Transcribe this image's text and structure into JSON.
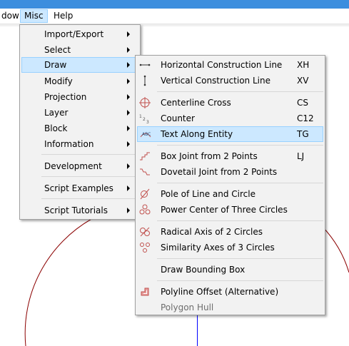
{
  "menubar": {
    "items": [
      {
        "label": "dow"
      },
      {
        "label": "Misc"
      },
      {
        "label": "Help"
      }
    ]
  },
  "misc_menu": {
    "items": [
      {
        "label": "Import/Export"
      },
      {
        "label": "Select"
      },
      {
        "label": "Draw"
      },
      {
        "label": "Modify"
      },
      {
        "label": "Projection"
      },
      {
        "label": "Layer"
      },
      {
        "label": "Block"
      },
      {
        "label": "Information"
      },
      {
        "label": "Development"
      },
      {
        "label": "Script Examples"
      },
      {
        "label": "Script Tutorials"
      }
    ]
  },
  "draw_menu": {
    "items": [
      {
        "label": "Horizontal Construction Line",
        "shortcut": "XH",
        "icon": "horizontal-line-icon"
      },
      {
        "label": "Vertical Construction Line",
        "shortcut": "XV",
        "icon": "vertical-line-icon"
      },
      {
        "label": "Centerline Cross",
        "shortcut": "CS",
        "icon": "centerline-cross-icon"
      },
      {
        "label": "Counter",
        "shortcut": "C12",
        "icon": "counter-icon"
      },
      {
        "label": "Text Along Entity",
        "shortcut": "TG",
        "icon": "text-along-entity-icon"
      },
      {
        "label": "Box Joint from 2 Points",
        "shortcut": "LJ",
        "icon": "box-joint-icon"
      },
      {
        "label": "Dovetail Joint from 2 Points",
        "shortcut": "",
        "icon": "dovetail-joint-icon"
      },
      {
        "label": "Pole of Line and Circle",
        "shortcut": "",
        "icon": "pole-icon"
      },
      {
        "label": "Power Center of Three Circles",
        "shortcut": "",
        "icon": "power-center-icon"
      },
      {
        "label": "Radical Axis of 2 Circles",
        "shortcut": "",
        "icon": "radical-axis-icon"
      },
      {
        "label": "Similarity Axes of 3 Circles",
        "shortcut": "",
        "icon": "similarity-axes-icon"
      },
      {
        "label": "Draw Bounding Box",
        "shortcut": "",
        "icon": ""
      },
      {
        "label": "Polyline Offset (Alternative)",
        "shortcut": "",
        "icon": "polyline-offset-icon"
      },
      {
        "label": "Polygon Hull",
        "shortcut": "",
        "icon": ""
      }
    ]
  },
  "colors": {
    "titlebar": "#3c8ede",
    "menu_highlight": "#cce8ff",
    "menu_highlight_border": "#99d1ff",
    "arc": "#8b0000",
    "axis": "#0000ff"
  }
}
